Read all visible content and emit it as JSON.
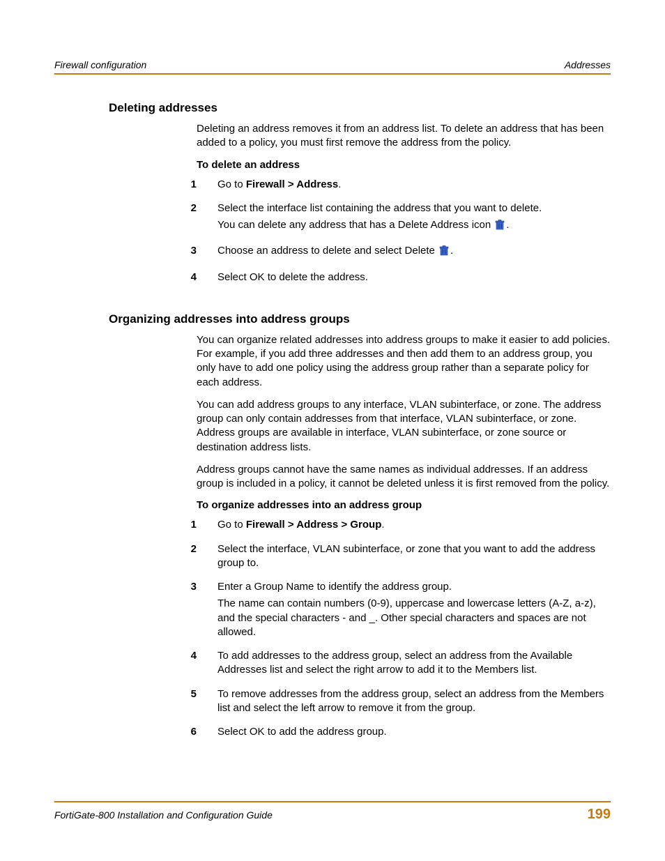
{
  "header": {
    "left": "Firewall configuration",
    "right": "Addresses"
  },
  "s1": {
    "title": "Deleting addresses",
    "intro": "Deleting an address removes it from an address list. To delete an address that has been added to a policy, you must first remove the address from the policy.",
    "howto_title": "To delete an address",
    "steps": {
      "n1": "1",
      "t1a": "Go to ",
      "t1b": "Firewall > Address",
      "t1c": ".",
      "n2": "2",
      "t2a": "Select the interface list containing the address that you want to delete.",
      "t2b_pre": "You can delete any address that has a Delete Address icon ",
      "t2b_post": ".",
      "n3": "3",
      "t3a": "Choose an address to delete and select Delete ",
      "t3b": ".",
      "n4": "4",
      "t4": "Select OK to delete the address."
    }
  },
  "s2": {
    "title": "Organizing addresses into address groups",
    "p1": "You can organize related addresses into address groups to make it easier to add policies. For example, if you add three addresses and then add them to an address group, you only have to add one policy using the address group rather than a separate policy for each address.",
    "p2": "You can add address groups to any interface, VLAN subinterface, or zone. The address group can only contain addresses from that interface, VLAN subinterface, or zone. Address groups are available in interface, VLAN subinterface, or zone source or destination address lists.",
    "p3": "Address groups cannot have the same names as individual addresses. If an address group is included in a policy, it cannot be deleted unless it is first removed from the policy.",
    "howto_title": "To organize addresses into an address group",
    "steps": {
      "n1": "1",
      "t1a": "Go to ",
      "t1b": "Firewall > Address > Group",
      "t1c": ".",
      "n2": "2",
      "t2": "Select the interface, VLAN subinterface, or zone that you want to add the address group to.",
      "n3": "3",
      "t3a": "Enter a Group Name to identify the address group.",
      "t3b": "The name can contain numbers (0-9), uppercase and lowercase letters (A-Z, a-z), and the special characters - and _. Other special characters and spaces are not allowed.",
      "n4": "4",
      "t4": "To add addresses to the address group, select an address from the Available Addresses list and select the right arrow to add it to the Members list.",
      "n5": "5",
      "t5": "To remove addresses from the address group, select an address from the Members list and select the left arrow to remove it from the group.",
      "n6": "6",
      "t6": "Select OK to add the address group."
    }
  },
  "footer": {
    "left": "FortiGate-800 Installation and Configuration Guide",
    "page": "199"
  }
}
